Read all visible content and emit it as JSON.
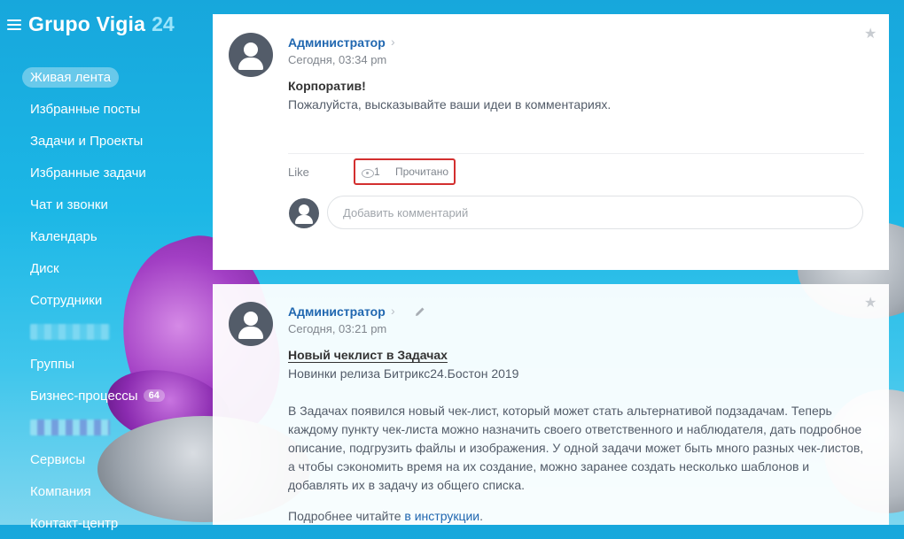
{
  "app": {
    "name": "Grupo Vigia",
    "number": "24"
  },
  "sidebar": {
    "items": [
      {
        "label": "Живая лента",
        "active": true
      },
      {
        "label": "Избранные посты"
      },
      {
        "label": "Задачи и Проекты"
      },
      {
        "label": "Избранные задачи"
      },
      {
        "label": "Чат и звонки"
      },
      {
        "label": "Календарь"
      },
      {
        "label": "Диск"
      },
      {
        "label": "Сотрудники"
      },
      {
        "label": "",
        "blurred": true
      },
      {
        "label": "Группы"
      },
      {
        "label": "Бизнес-процессы",
        "counter": "64"
      },
      {
        "label": "",
        "blurred": true
      },
      {
        "label": "Сервисы"
      },
      {
        "label": "Компания"
      },
      {
        "label": "Контакт-центр"
      }
    ]
  },
  "posts": [
    {
      "author": "Администратор",
      "date": "Сегодня, 03:34 pm",
      "title": "Корпоратив!",
      "body": "Пожалуйста, высказывайте ваши идеи в комментариях.",
      "like_label": "Like",
      "views": "1",
      "read_label": "Прочитано",
      "comment_placeholder": "Добавить комментарий"
    },
    {
      "author": "Администратор",
      "date": "Сегодня, 03:21 pm",
      "title": "Новый чеклист в Задачах",
      "subtitle": "Новинки релиза Битрикс24.Бостон 2019",
      "paragraph_lines": [
        "В Задачах появился новый чек-лист, который может стать альтернативой подзадачам. Теперь",
        "каждому пункту чек-листа можно назначить своего ответственного и наблюдателя, дать подробное",
        "описание, подгрузить файлы и изображения. У одной задачи может быть много разных чек-листов,",
        "а чтобы сэкономить время на их создание, можно заранее создать несколько шаблонов и",
        "добавлять их в задачу из общего списка."
      ],
      "more_prefix": "Подробнее читайте ",
      "more_link": "в инструкции",
      "more_suffix": "."
    }
  ],
  "colors": {
    "accent": "#2067b0",
    "highlight_box": "#d32f2f",
    "sidebar_bg": "#17a7dc"
  }
}
